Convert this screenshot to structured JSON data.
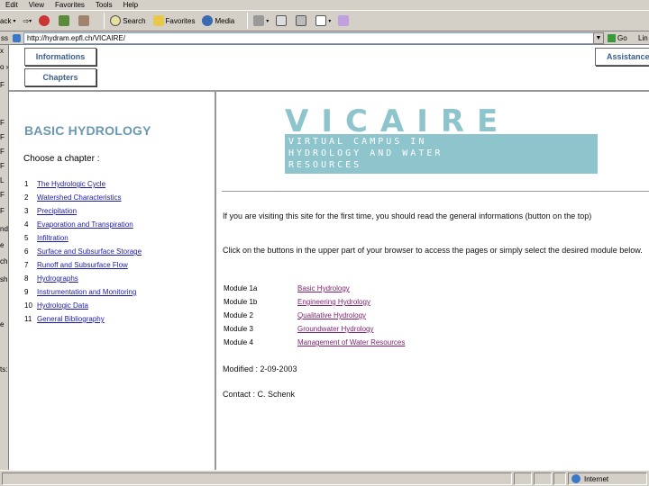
{
  "menu": [
    "Edit",
    "View",
    "Favorites",
    "Tools",
    "Help"
  ],
  "toolbar": {
    "back_label": "ack",
    "search_label": "Search",
    "favorites_label": "Favorites",
    "media_label": "Media"
  },
  "address": {
    "label": "ss",
    "url": "http://hydram.epfl.ch/VICAIRE/",
    "go_label": "Go",
    "links_label": "Lin"
  },
  "left_strip": [
    "x",
    "o »",
    "F",
    "F",
    "F",
    "F",
    "F",
    "L",
    "F",
    "F",
    "nd",
    "e",
    "ch",
    "sh",
    "e",
    "ts:"
  ],
  "nav": {
    "informations": "Informations",
    "chapters": "Chapters",
    "assistance": "Assistance"
  },
  "left_pane": {
    "title": "BASIC HYDROLOGY",
    "choose": "Choose a chapter :",
    "chapters": [
      {
        "num": "1",
        "label": "The Hydrologic Cycle"
      },
      {
        "num": "2",
        "label": "Watershed Characteristics"
      },
      {
        "num": "3",
        "label": "Precipitation"
      },
      {
        "num": "4",
        "label": "Evaporation and Transpiration"
      },
      {
        "num": "5",
        "label": "Infiltration"
      },
      {
        "num": "6",
        "label": "Surface and Subsurface Storage"
      },
      {
        "num": "7",
        "label": "Runoff and Subsurface Flow"
      },
      {
        "num": "8",
        "label": "Hydrographs"
      },
      {
        "num": "9",
        "label": "Instrumentation and Monitoring"
      },
      {
        "num": "10",
        "label": "Hydrologic Data"
      },
      {
        "num": "11",
        "label": "General Bibliography"
      }
    ]
  },
  "logo": {
    "title": "VICAIRE",
    "line1": "Virtual Campus in",
    "line2": "Hydrology and Water",
    "line3": "Resources",
    "color": "#8ec4cc"
  },
  "main": {
    "intro": "If you are visiting this site for the first time, you should read the general informations (button on the top)",
    "instruction": "Click on the buttons in the upper part of your browser to access the pages or simply select the desired module below.",
    "modules": [
      {
        "label": "Module 1a",
        "link": "Basic Hydrology"
      },
      {
        "label": "Module 1b",
        "link": "Engineering Hydrology"
      },
      {
        "label": "Module 2",
        "link": "Qualitative Hydrology"
      },
      {
        "label": "Module 3",
        "link": "Groundwater Hydrology"
      },
      {
        "label": "Module 4",
        "link": "Management of Water Resources"
      }
    ],
    "modified": "Modified : 2-09-2003",
    "contact": "Contact : C. Schenk"
  },
  "status": {
    "zone": "Internet"
  }
}
